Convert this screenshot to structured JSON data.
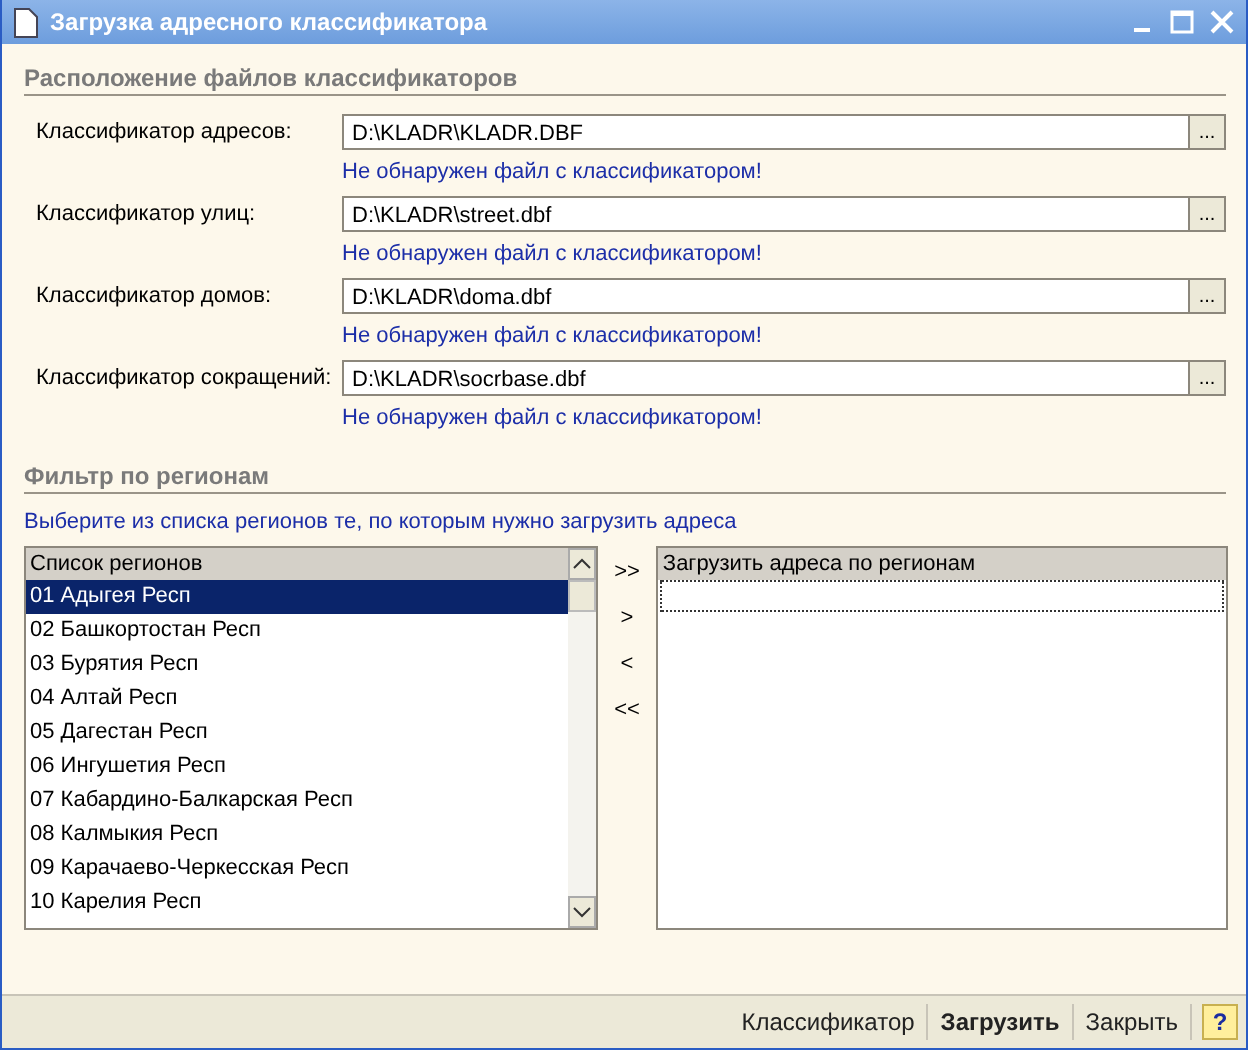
{
  "window": {
    "title": "Загрузка адресного классификатора"
  },
  "files_section": {
    "title": "Расположение файлов классификаторов",
    "rows": [
      {
        "label": "Классификатор адресов:",
        "value": "D:\\KLADR\\KLADR.DBF",
        "button": "...",
        "warning": "Не обнаружен файл с классификатором!"
      },
      {
        "label": "Классификатор улиц:",
        "value": "D:\\KLADR\\street.dbf",
        "button": "...",
        "warning": "Не обнаружен файл с классификатором!"
      },
      {
        "label": "Классификатор домов:",
        "value": "D:\\KLADR\\doma.dbf",
        "button": "...",
        "warning": "Не обнаружен файл с классификатором!"
      },
      {
        "label": "Классификатор сокращений:",
        "value": "D:\\KLADR\\socrbase.dbf",
        "button": "...",
        "warning": "Не обнаружен файл с классификатором!"
      }
    ]
  },
  "filter_section": {
    "title": "Фильтр по регионам",
    "hint": "Выберите из списка регионов те, по которым нужно загрузить адреса",
    "regions_list": {
      "header": "Список регионов",
      "items": [
        {
          "label": "01 Адыгея Респ",
          "selected": true
        },
        {
          "label": "02 Башкортостан Респ",
          "selected": false
        },
        {
          "label": "03 Бурятия Респ",
          "selected": false
        },
        {
          "label": "04 Алтай Респ",
          "selected": false
        },
        {
          "label": "05 Дагестан Респ",
          "selected": false
        },
        {
          "label": "06 Ингушетия Респ",
          "selected": false
        },
        {
          "label": "07 Кабардино-Балкарская Респ",
          "selected": false
        },
        {
          "label": "08 Калмыкия Респ",
          "selected": false
        },
        {
          "label": "09 Карачаево-Черкесская Респ",
          "selected": false
        },
        {
          "label": "10 Карелия Респ",
          "selected": false
        }
      ]
    },
    "move_buttons": [
      ">>",
      ">",
      "<",
      "<<"
    ],
    "selected_list": {
      "header": "Загрузить адреса по регионам"
    }
  },
  "footer": {
    "buttons": [
      {
        "label": "Классификатор",
        "default": false
      },
      {
        "label": "Загрузить",
        "default": true
      },
      {
        "label": "Закрыть",
        "default": false
      }
    ],
    "help": "?"
  }
}
